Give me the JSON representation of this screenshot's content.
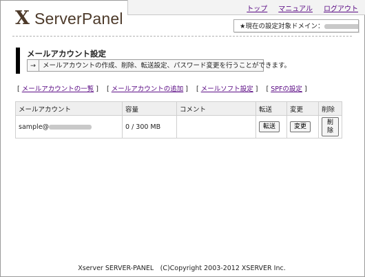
{
  "header": {
    "logo_mark": "X",
    "logo_text": "ServerPanel",
    "nav": [
      "トップ",
      "マニュアル",
      "ログアウト"
    ],
    "domain_label": "★現在の設定対象ドメイン："
  },
  "page": {
    "title": "メールアカウント設定",
    "desc_arrow": "→",
    "description": "メールアカウントの作成、削除、転送設定、パスワード変更を行うことができます。"
  },
  "links": [
    "メールアカウントの一覧",
    "メールアカウントの追加",
    "メールソフト設定",
    "SPFの設定"
  ],
  "table": {
    "headers": [
      "メールアカウント",
      "容量",
      "コメント",
      "転送",
      "変更",
      "削除"
    ],
    "rows": [
      {
        "account_prefix": "sample@",
        "capacity": "0 / 300 MB",
        "comment": "",
        "forward_label": "転送",
        "change_label": "変更",
        "delete_label": "削除"
      }
    ]
  },
  "footer": "Xserver SERVER-PANEL　(C)Copyright 2003-2012 XSERVER Inc."
}
